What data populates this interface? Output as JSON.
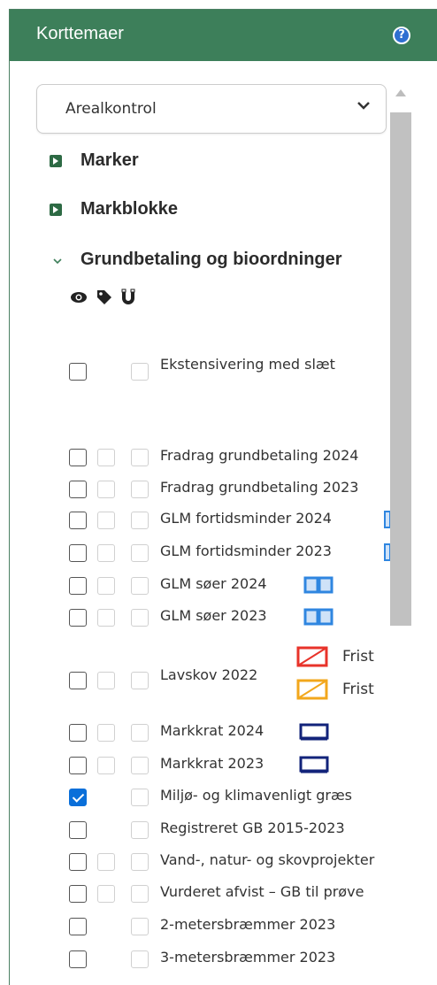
{
  "panel": {
    "title": "Korttemaer",
    "help_icon": "question-circle-icon"
  },
  "select": {
    "value": "Arealkontrol"
  },
  "groups": [
    {
      "label": "Marker",
      "state": "collapsed"
    },
    {
      "label": "Markblokke",
      "state": "collapsed"
    },
    {
      "label": "Grundbetaling og bioordninger",
      "state": "expanded"
    }
  ],
  "tool_icons": [
    "eye-icon",
    "tag-icon",
    "magnet-icon"
  ],
  "rows": [
    {
      "label": "Ekstensivering med slæt",
      "checked": false
    },
    {
      "label": "Fradrag grundbetaling 2024",
      "checked": false
    },
    {
      "label": "Fradrag grundbetaling 2023",
      "checked": false
    },
    {
      "label": "GLM fortidsminder 2024",
      "checked": false
    },
    {
      "label": "GLM fortidsminder 2023",
      "checked": false
    },
    {
      "label": "GLM søer 2024",
      "checked": false
    },
    {
      "label": "GLM søer 2023",
      "checked": false
    },
    {
      "label": "Lavskov 2022",
      "checked": false,
      "legend": [
        {
          "text": "Frist",
          "color": "#e8332a"
        },
        {
          "text": "Frist",
          "color": "#f2a71c"
        }
      ]
    },
    {
      "label": "Markkrat 2024",
      "checked": false
    },
    {
      "label": "Markkrat 2023",
      "checked": false
    },
    {
      "label": "Miljø- og klimavenligt græs",
      "checked": true
    },
    {
      "label": "Registreret GB 2015-2023",
      "checked": false
    },
    {
      "label": "Vand-, natur- og skovprojekter",
      "checked": false
    },
    {
      "label": "Vurderet afvist – GB til prøve",
      "checked": false
    },
    {
      "label": "2-metersbræmmer 2023",
      "checked": false
    },
    {
      "label": "3-metersbræmmer 2023",
      "checked": false
    }
  ],
  "colors": {
    "header": "#3d7f5a",
    "expand": "#2d6a44",
    "check": "#0a6fd9",
    "legend_blue": "#2f86e0",
    "legend_navy": "#12237a"
  }
}
